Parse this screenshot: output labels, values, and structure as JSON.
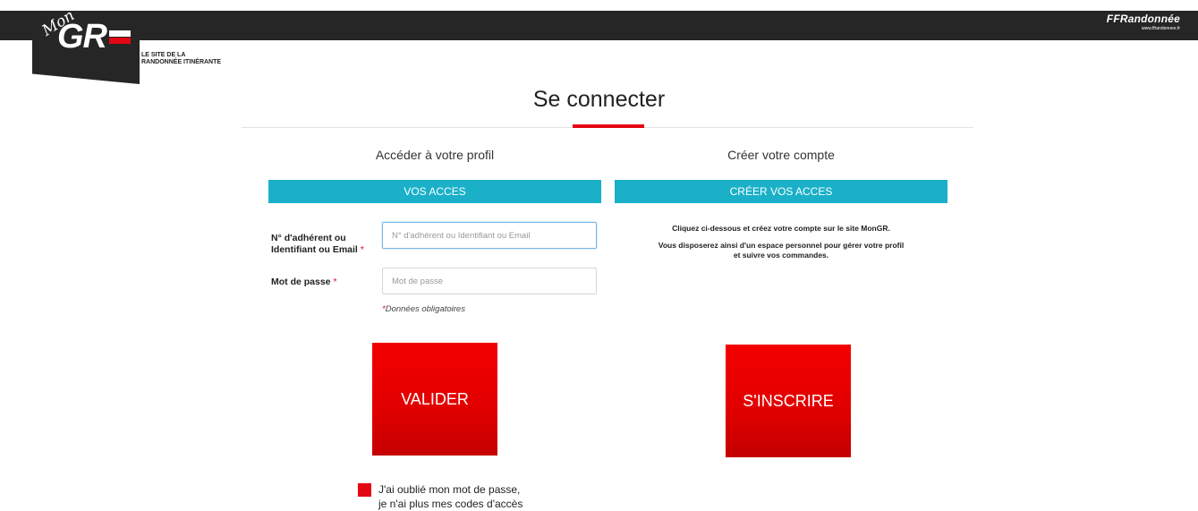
{
  "header": {
    "logo_mon": "Mon",
    "logo_gr": "GR",
    "tagline_line1": "LE SITE DE LA",
    "tagline_line2": "RANDONNÉE ITINÉRANTE",
    "partner_name": "FFRandonnée",
    "partner_url": "www.ffrandonnee.fr"
  },
  "page": {
    "title": "Se connecter",
    "accent_color": "#e30613",
    "bar_color": "#1ab0c8"
  },
  "login": {
    "title": "Accéder à votre profil",
    "bar": "VOS ACCES",
    "id_label_line1": "N° d'adhérent ou",
    "id_label_line2": "Identifiant ou Email",
    "required_mark": "*",
    "id_placeholder": "N° d'adhérent ou Identifiant ou Email",
    "id_value": "",
    "password_label": "Mot de passe",
    "password_placeholder": "Mot de passe",
    "password_value": "",
    "required_note": "Données obligatoires",
    "submit_label": "VALIDER",
    "forgot_line1": "J'ai oublié mon mot de passe,",
    "forgot_line2": "je n'ai plus mes codes d'accès"
  },
  "register": {
    "title": "Créer votre compte",
    "bar": "CRÉER VOS ACCES",
    "info_line1": "Cliquez ci-dessous et créez votre compte sur le site MonGR.",
    "info_line2": "Vous disposerez ainsi d'un espace personnel pour gérer votre profil",
    "info_line3": "et suivre vos commandes.",
    "submit_label": "S'INSCRIRE"
  }
}
